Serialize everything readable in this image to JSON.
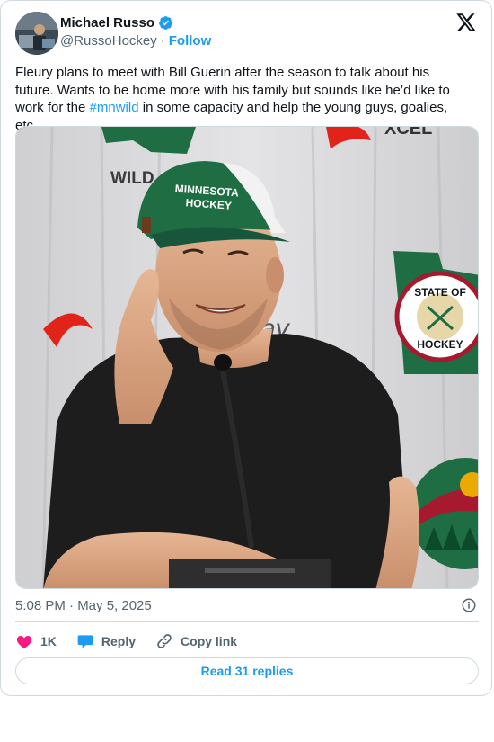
{
  "author": {
    "name": "Michael Russo",
    "handle": "@RussoHockey",
    "separator": "·",
    "follow_label": "Follow",
    "verified": true
  },
  "tweet": {
    "text_part1": "Fleury plans to meet with Bill Guerin after the season to talk about his future. Wants to be home more with his family but sounds like he’d like to work for the ",
    "hashtag": "#mnwild",
    "text_part2": " in some capacity and help the young guys, goalies, etc.",
    "time": "5:08 PM · May 5, 2025"
  },
  "photo": {
    "backdrop_texts": [
      "WILD",
      "ray",
      "XCEL"
    ],
    "cap_text": [
      "MINNESOTA",
      "HOCKEY"
    ],
    "badge_text": [
      "STATE OF",
      "HOCKEY"
    ]
  },
  "actions": {
    "like_count": "1K",
    "reply_label": "Reply",
    "copy_label": "Copy link"
  },
  "replies_button_label": "Read 31 replies",
  "colors": {
    "accent": "#1d9bf0",
    "like": "#f91880",
    "muted": "#536471",
    "border": "#cfd9de"
  },
  "icons": [
    "verified-badge-icon",
    "x-logo-icon",
    "info-icon",
    "heart-icon",
    "reply-bubble-icon",
    "link-icon"
  ]
}
